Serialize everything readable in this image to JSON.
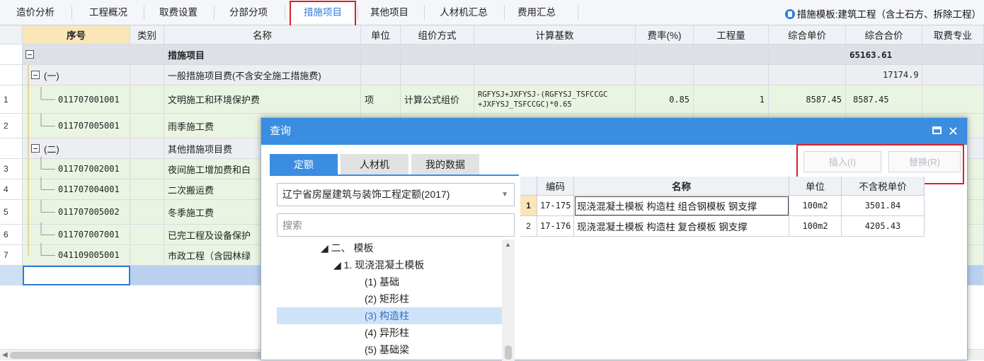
{
  "tabs": [
    "造价分析",
    "工程概况",
    "取费设置",
    "分部分项",
    "措施项目",
    "其他项目",
    "人材机汇总",
    "费用汇总"
  ],
  "active_tab": "措施项目",
  "template_label": "措施模板:建筑工程（含土石方、拆除工程）",
  "columns": [
    "序号",
    "类别",
    "名称",
    "单位",
    "组价方式",
    "计算基数",
    "费率(%)",
    "工程量",
    "综合单价",
    "综合合价",
    "取费专业"
  ],
  "rows": [
    {
      "rownum": "",
      "seq": "",
      "name": "措施项目",
      "total": "65163.61"
    },
    {
      "rownum": "",
      "seq": "(一)",
      "name": "一般措施项目费(不含安全施工措施费)",
      "total": "17174.9"
    },
    {
      "rownum": "1",
      "seq": "011707001001",
      "name": "文明施工和环境保护费",
      "unit": "项",
      "method": "计算公式组价",
      "base1": "RGFYSJ+JXFYSJ-(RGFYSJ_TSFCCGC",
      "base2": "+JXFYSJ_TSFCCGC)*0.65",
      "rate": "0.85",
      "qty": "1",
      "price": "8587.45",
      "total": "8587.45"
    },
    {
      "rownum": "2",
      "seq": "011707005001",
      "name": "雨季施工费"
    },
    {
      "rownum": "",
      "seq": "(二)",
      "name": "其他措施项目费"
    },
    {
      "rownum": "3",
      "seq": "011707002001",
      "name": "夜间施工增加费和白"
    },
    {
      "rownum": "4",
      "seq": "011707004001",
      "name": "二次搬运费"
    },
    {
      "rownum": "5",
      "seq": "011707005002",
      "name": "冬季施工费"
    },
    {
      "rownum": "6",
      "seq": "011707007001",
      "name": "已完工程及设备保护"
    },
    {
      "rownum": "7",
      "seq": "041109005001",
      "name": "市政工程（含园林绿"
    }
  ],
  "dialog": {
    "title": "查询",
    "tabs": [
      "定额",
      "人材机",
      "我的数据"
    ],
    "insert_label": "插入(I)",
    "replace_label": "替换(R)",
    "dropdown_value": "辽宁省房屋建筑与装饰工程定额(2017)",
    "search_placeholder": "搜索",
    "tree": [
      {
        "label": "◢ 二、 模板",
        "level": 0
      },
      {
        "label": "◢ 1. 现浇混凝土模板",
        "level": 1
      },
      {
        "label": "(1) 基础",
        "level": 2
      },
      {
        "label": "(2) 矩形柱",
        "level": 2
      },
      {
        "label": "(3) 构造柱",
        "level": 2,
        "selected": true
      },
      {
        "label": "(4) 异形柱",
        "level": 2
      },
      {
        "label": "(5) 基础梁",
        "level": 2
      }
    ],
    "columns": [
      "编码",
      "名称",
      "单位",
      "不含税单价"
    ],
    "results": [
      {
        "n": "1",
        "code": "17-175",
        "name": "现浇混凝土模板 构造柱 组合钢模板 钢支撑",
        "unit": "100m2",
        "price": "3501.84"
      },
      {
        "n": "2",
        "code": "17-176",
        "name": "现浇混凝土模板 构造柱 复合模板 钢支撑",
        "unit": "100m2",
        "price": "4205.43"
      }
    ]
  }
}
